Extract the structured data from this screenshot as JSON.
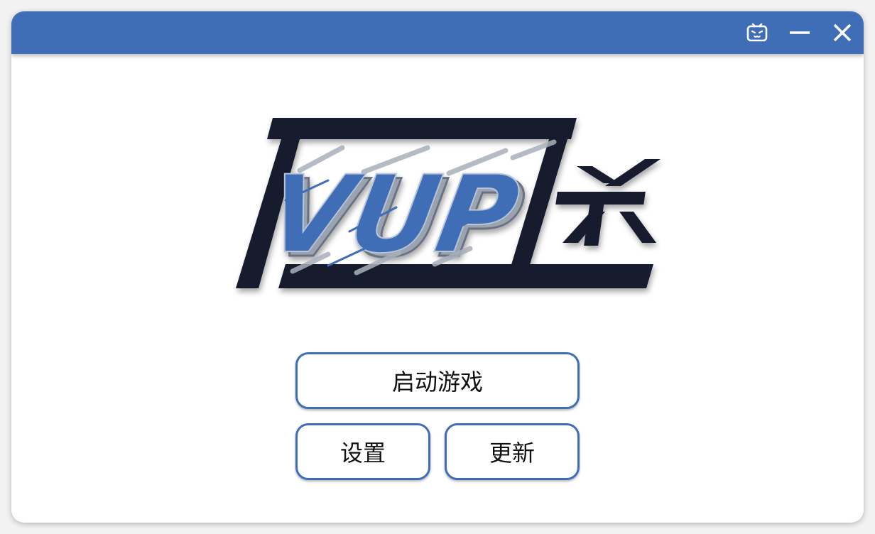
{
  "colors": {
    "titlebar": "#3f6eb6",
    "accent": "#3f6eb6",
    "logo_dark": "#141e2e",
    "background": "#ffffff"
  },
  "titlebar": {
    "icons": [
      "bilibili-icon",
      "minimize-icon",
      "close-icon"
    ]
  },
  "logo": {
    "text": "VUP",
    "suffix": "杀"
  },
  "buttons": {
    "start": "启动游戏",
    "settings": "设置",
    "update": "更新"
  }
}
